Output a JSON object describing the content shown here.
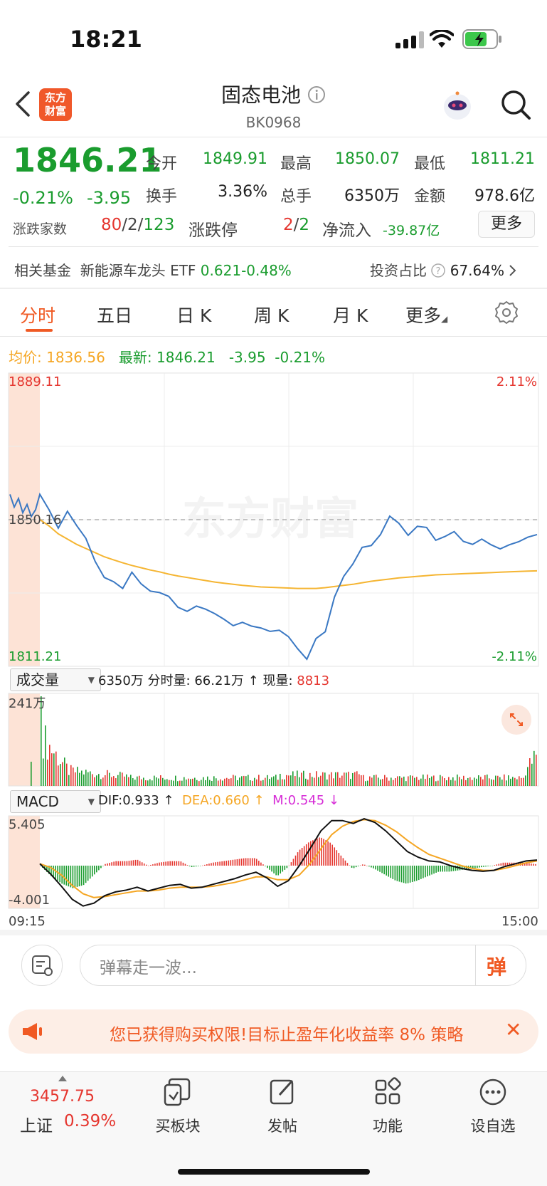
{
  "status_bar": {
    "time": "18:21"
  },
  "header": {
    "logo_line1": "东方",
    "logo_line2": "财富",
    "title": "固态电池",
    "code": "BK0968"
  },
  "quote": {
    "price": "1846.21",
    "change_pct": "-0.21%",
    "change": "-3.95",
    "open_label": "今开",
    "open": "1849.91",
    "high_label": "最高",
    "high": "1850.07",
    "low_label": "最低",
    "low": "1811.21",
    "turnover_label": "换手",
    "turnover": "3.36%",
    "volume_label": "总手",
    "volume": "6350万",
    "amount_label": "金额",
    "amount": "978.6亿",
    "updown_label": "涨跌家数",
    "up": "80",
    "flat": "2",
    "down": "123",
    "limit_label": "涨跌停",
    "limit_up": "2",
    "limit_down": "2",
    "netflow_label": "净流入",
    "netflow": "-39.87亿",
    "more_button": "更多"
  },
  "fund": {
    "label": "相关基金",
    "name": "新能源车龙头 ETF",
    "price": "0.621",
    "pct": "-0.48%",
    "invest_label": "投资占比",
    "invest_value": "67.64%"
  },
  "tabs": [
    "分时",
    "五日",
    "日 K",
    "周 K",
    "月 K",
    "更多"
  ],
  "legend": {
    "avg_label": "均价:",
    "avg": "1836.56",
    "latest_label": "最新:",
    "latest": "1846.21",
    "change": "-3.95",
    "pct": "-0.21%"
  },
  "price_chart": {
    "max_label": "1889.11",
    "min_label": "1811.21",
    "prev_label": "1850.16",
    "max_pct": "2.11%",
    "min_pct": "-2.11%",
    "watermark": "东方财富"
  },
  "volume_panel": {
    "select": "成交量",
    "total": "6350万",
    "minute_label": "分时量:",
    "minute": "66.21万",
    "arrow": "↑",
    "now_label": "现量:",
    "now": "8813",
    "max_label": "241万"
  },
  "macd_panel": {
    "select": "MACD",
    "dif": "DIF:0.933 ↑",
    "dea": "DEA:0.660 ↑",
    "m": "M:0.545 ↓",
    "max_label": "5.405",
    "min_label": "-4.001"
  },
  "time_axis": {
    "start": "09:15",
    "end": "15:00"
  },
  "danmu": {
    "placeholder": "弹幕走一波...",
    "button": "弹"
  },
  "banner": {
    "text": "您已获得购买权限!目标止盈年化收益率 8% 策略"
  },
  "bottom_nav": {
    "index_value": "3457.75",
    "index_name": "上证",
    "index_pct": "0.39%",
    "items": [
      "买板块",
      "发帖",
      "功能",
      "设自选"
    ]
  },
  "chart_data": {
    "type": "line",
    "prev_close": 1850.16,
    "ylim": [
      1811.21,
      1889.11
    ],
    "price": [
      1856.9,
      1852.8,
      1847.9,
      1852.4,
      1848.6,
      1845.2,
      1839.1,
      1834.8,
      1833.7,
      1831.9,
      1836.2,
      1833.1,
      1831.2,
      1830.8,
      1829.8,
      1826.9,
      1825.8,
      1827.2,
      1826.4,
      1825.2,
      1823.7,
      1822.0,
      1822.9,
      1821.9,
      1821.4,
      1820.5,
      1820.8,
      1819.1,
      1815.9,
      1813.1,
      1818.6,
      1820.4,
      1829.6,
      1835.1,
      1838.4,
      1842.8,
      1843.3,
      1846.2,
      1851.1,
      1849.2,
      1846.0,
      1848.4,
      1848.1,
      1844.7,
      1845.7,
      1847.0,
      1844.4,
      1843.6,
      1845.0,
      1843.5,
      1842.4,
      1843.5,
      1844.3,
      1845.5,
      1846.2
    ],
    "avg": [
      1850.2,
      1848.5,
      1846.4,
      1845.0,
      1843.6,
      1842.5,
      1841.4,
      1840.3,
      1839.5,
      1838.7,
      1838.0,
      1837.4,
      1836.8,
      1836.3,
      1835.7,
      1835.2,
      1834.8,
      1834.4,
      1834.0,
      1833.6,
      1833.3,
      1833.0,
      1832.7,
      1832.5,
      1832.3,
      1832.2,
      1832.1,
      1832.0,
      1831.9,
      1831.9,
      1831.9,
      1832.1,
      1832.4,
      1832.7,
      1833.0,
      1833.4,
      1833.8,
      1834.1,
      1834.4,
      1834.7,
      1834.9,
      1835.1,
      1835.3,
      1835.5,
      1835.6,
      1835.7,
      1835.8,
      1835.9,
      1836.0,
      1836.1,
      1836.2,
      1836.3,
      1836.4,
      1836.5,
      1836.56
    ],
    "volume_ylim": [
      0,
      241
    ],
    "macd_ylim": [
      -4.001,
      5.405
    ]
  }
}
